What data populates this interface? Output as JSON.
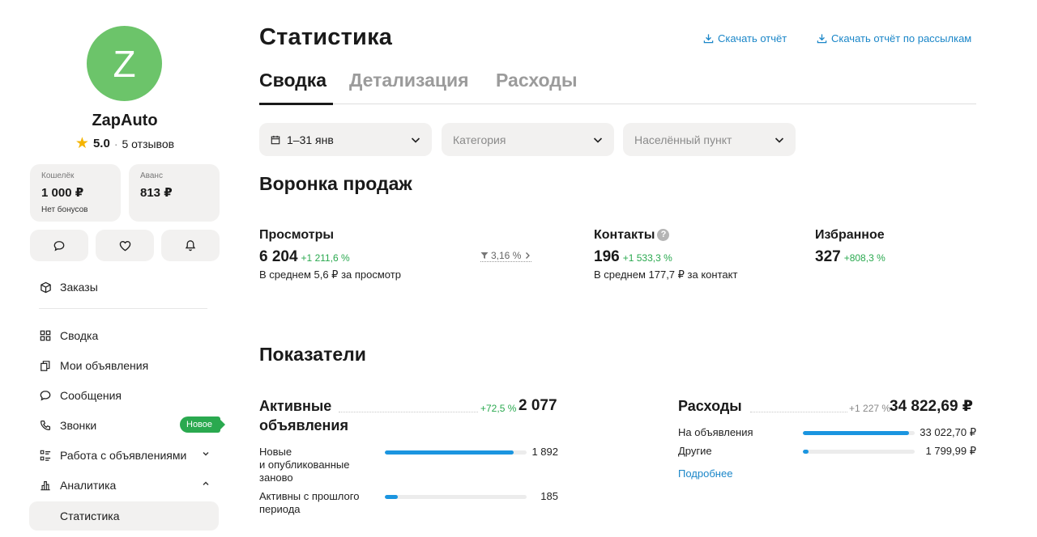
{
  "sidebar": {
    "avatar_letter": "Z",
    "avatar_color": "#6cc46a",
    "shop_name": "ZapAuto",
    "rating": "5.0",
    "reviews": "5 отзывов",
    "wallet": {
      "caption": "Кошелёк",
      "amount": "1 000 ₽",
      "note": "Нет бонусов"
    },
    "advance": {
      "caption": "Аванс",
      "amount": "813 ₽"
    },
    "quick_icons": [
      "chat-icon",
      "heart-icon",
      "bell-icon"
    ],
    "orders": "Заказы",
    "items": [
      {
        "label": "Сводка",
        "icon": "grid-icon"
      },
      {
        "label": "Мои объявления",
        "icon": "copy-icon"
      },
      {
        "label": "Сообщения",
        "icon": "chat-icon"
      },
      {
        "label": "Звонки",
        "icon": "phone-icon",
        "badge": "Новое"
      },
      {
        "label": "Работа с объявлениями",
        "icon": "list-icon"
      },
      {
        "label": "Аналитика",
        "icon": "chart-icon"
      }
    ],
    "active_sub": "Статистика"
  },
  "header": {
    "title": "Статистика",
    "download_report": "Скачать отчёт",
    "download_mailing": "Скачать отчёт по рассылкам"
  },
  "tabs": [
    {
      "label": "Сводка",
      "active": true
    },
    {
      "label": "Детализация",
      "active": false
    },
    {
      "label": "Расходы",
      "active": false
    }
  ],
  "filters": {
    "date": "1–31 янв",
    "category": "Категория",
    "city": "Населённый пункт"
  },
  "funnel": {
    "title": "Воронка продаж",
    "views": {
      "label": "Просмотры",
      "value": "6 204",
      "delta": "+1 211,6 %",
      "note": "В среднем 5,6 ₽ за просмотр"
    },
    "conversion": "3,16 %",
    "contacts": {
      "label": "Контакты",
      "help": "?",
      "value": "196",
      "delta": "+1 533,3 %",
      "note": "В среднем 177,7 ₽ за контакт"
    },
    "favorites": {
      "label": "Избранное",
      "value": "327",
      "delta": "+808,3 %"
    }
  },
  "indicators": {
    "title": "Показатели",
    "active": {
      "title_line1": "Активные",
      "title_line2": "объявления",
      "delta": "+72,5 %",
      "total": "2 077",
      "rows": [
        {
          "label_lines": [
            "Новые",
            "и опубликованные",
            "заново"
          ],
          "value": "1 892",
          "fraction": 0.911
        },
        {
          "label_lines": [
            "Активны с прошлого",
            "периода"
          ],
          "value": "185",
          "fraction": 0.089
        }
      ]
    },
    "expenses": {
      "title": "Расходы",
      "delta": "+1 227 %",
      "total": "34 822,69 ₽",
      "rows": [
        {
          "label": "На объявления",
          "value": "33 022,70 ₽",
          "fraction": 0.948
        },
        {
          "label": "Другие",
          "value": "1 799,99 ₽",
          "fraction": 0.052
        }
      ],
      "more": "Подробнее"
    }
  }
}
